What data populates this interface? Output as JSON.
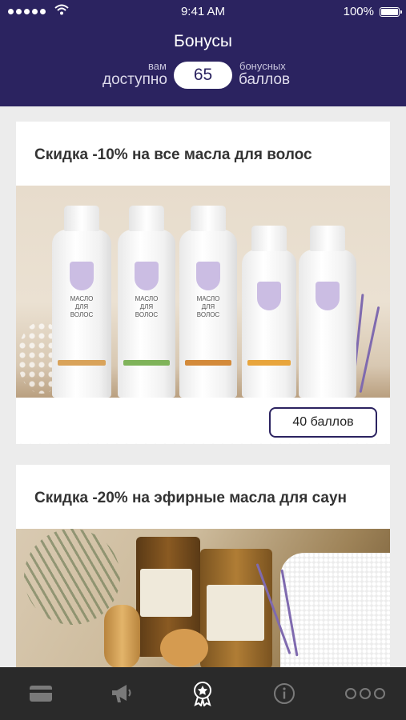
{
  "status_bar": {
    "time": "9:41 AM",
    "battery": "100%"
  },
  "header": {
    "title": "Бонусы",
    "available_small": "вам",
    "available_big": "доступно",
    "points": "65",
    "unit_small": "бонусных",
    "unit_big": "баллов"
  },
  "cards": [
    {
      "title": "Скидка -10% на все масла для волос",
      "price": "40 баллов",
      "bottle_labels": [
        "МАСЛО\nДЛЯ ВОЛОС",
        "МАСЛО\nДЛЯ ВОЛОС",
        "МАСЛО\nДЛЯ ВОЛОС",
        "",
        ""
      ]
    },
    {
      "title": "Скидка -20% на эфирные масла для саун"
    }
  ],
  "tabbar": {
    "items": [
      {
        "icon": "card-icon",
        "active": false
      },
      {
        "icon": "megaphone-icon",
        "active": false
      },
      {
        "icon": "badge-star-icon",
        "active": true
      },
      {
        "icon": "info-icon",
        "active": false
      },
      {
        "icon": "more-dots-icon",
        "active": false
      }
    ]
  },
  "colors": {
    "header_bg": "#2b2360",
    "accent": "#2b2360",
    "tabbar_bg": "#2a2a2a",
    "page_bg": "#ececec"
  }
}
